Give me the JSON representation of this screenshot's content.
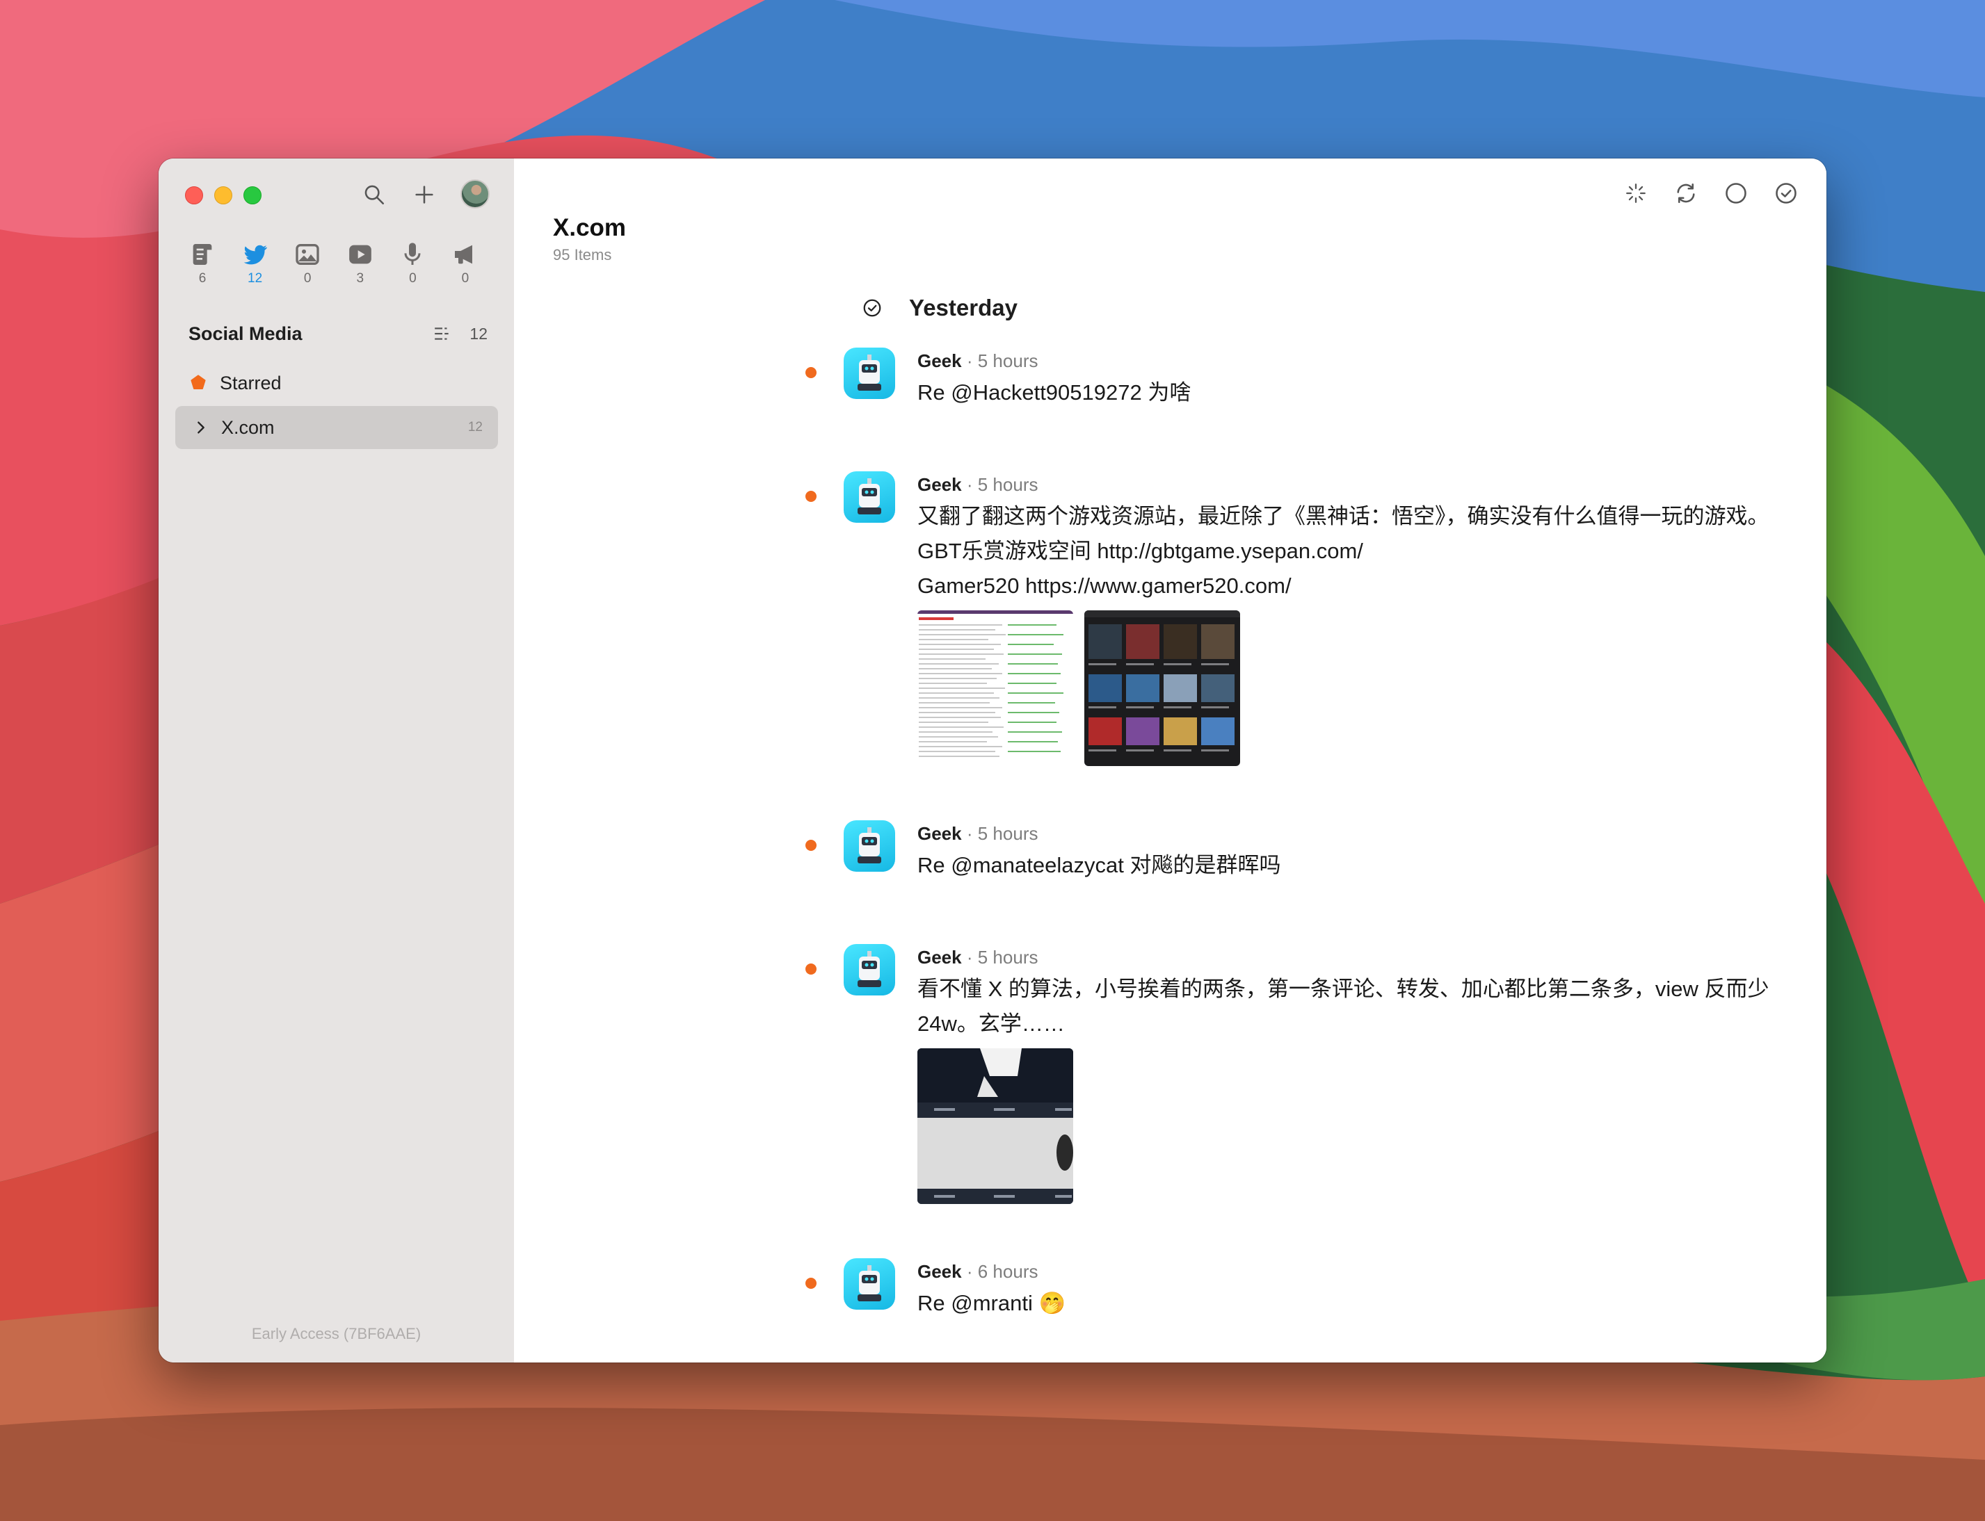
{
  "window": {
    "toolbar_left": {
      "search_icon": "search-icon",
      "add_icon": "plus-icon",
      "avatar": "avatar"
    },
    "toolbar_right": [
      "sparkles-icon",
      "refresh-icon",
      "circle-icon",
      "checkmark-circle-icon"
    ]
  },
  "sidebar": {
    "types": [
      {
        "icon": "article-icon",
        "count": "6",
        "active": false
      },
      {
        "icon": "twitter-icon",
        "count": "12",
        "active": true
      },
      {
        "icon": "photo-icon",
        "count": "0",
        "active": false
      },
      {
        "icon": "video-icon",
        "count": "3",
        "active": false
      },
      {
        "icon": "microphone-icon",
        "count": "0",
        "active": false
      },
      {
        "icon": "megaphone-icon",
        "count": "0",
        "active": false
      }
    ],
    "section_title": "Social Media",
    "section_count": "12",
    "items": [
      {
        "label": "Starred",
        "count": ""
      },
      {
        "label": "X.com",
        "count": "12"
      }
    ],
    "footer": "Early Access (7BF6AAE)"
  },
  "main": {
    "title": "X.com",
    "subtitle": "95 Items",
    "day_label": "Yesterday",
    "items": [
      {
        "author": "Geek",
        "sep": "·",
        "time": "5 hours",
        "text": [
          "Re @Hackett90519272 为啥"
        ]
      },
      {
        "author": "Geek",
        "sep": "·",
        "time": "5 hours",
        "text": [
          "又翻了翻这两个游戏资源站，最近除了《黑神话：悟空》，确实没有什么值得一玩的游戏。",
          "GBT乐赏游戏空间 http://gbtgame.ysepan.com/",
          "Gamer520 https://www.gamer520.com/"
        ]
      },
      {
        "author": "Geek",
        "sep": "·",
        "time": "5 hours",
        "text": [
          "Re @manateelazycat 对飚的是群晖吗"
        ]
      },
      {
        "author": "Geek",
        "sep": "·",
        "time": "5 hours",
        "text": [
          "看不懂 X 的算法，小号挨着的两条，第一条评论、转发、加心都比第二条多，view 反而少",
          "24w。玄学……"
        ]
      },
      {
        "author": "Geek",
        "sep": "·",
        "time": "6 hours",
        "text": [
          "Re @mranti 🤭"
        ]
      }
    ]
  }
}
